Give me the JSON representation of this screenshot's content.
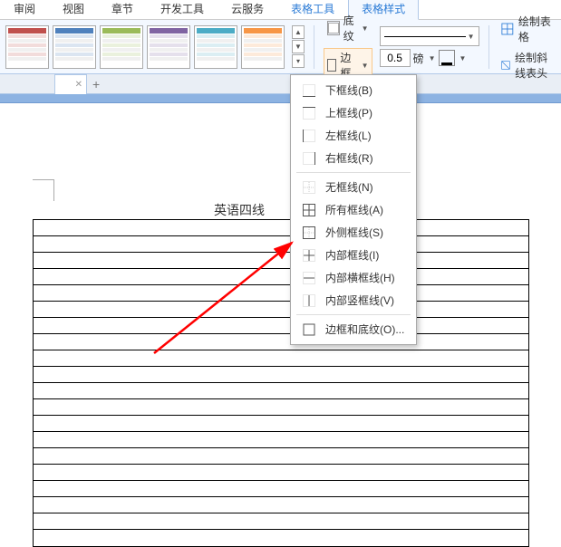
{
  "tabs": {
    "items": [
      {
        "label": "审阅",
        "active": false
      },
      {
        "label": "视图",
        "active": false
      },
      {
        "label": "章节",
        "active": false
      },
      {
        "label": "开发工具",
        "active": false
      },
      {
        "label": "云服务",
        "active": false
      },
      {
        "label": "表格工具",
        "active": false,
        "highlight": true
      },
      {
        "label": "表格样式",
        "active": true
      }
    ]
  },
  "ribbon": {
    "shading_label": "底纹",
    "border_label": "边框",
    "weight_value": "0.5",
    "weight_unit": "磅",
    "draw_table": "绘制表格",
    "draw_diagonal": "绘制斜线表头"
  },
  "document": {
    "title_fragment": "英语四线"
  },
  "border_menu": {
    "items": [
      {
        "label": "下框线(B)",
        "icon": "border-bottom"
      },
      {
        "label": "上框线(P)",
        "icon": "border-top"
      },
      {
        "label": "左框线(L)",
        "icon": "border-left"
      },
      {
        "label": "右框线(R)",
        "icon": "border-right"
      },
      {
        "label": "无框线(N)",
        "icon": "border-none",
        "sep_before": true
      },
      {
        "label": "所有框线(A)",
        "icon": "border-all"
      },
      {
        "label": "外侧框线(S)",
        "icon": "border-outside"
      },
      {
        "label": "内部框线(I)",
        "icon": "border-inside"
      },
      {
        "label": "内部横框线(H)",
        "icon": "border-inside-h"
      },
      {
        "label": "内部竖框线(V)",
        "icon": "border-inside-v"
      },
      {
        "label": "边框和底纹(O)...",
        "icon": "border-dialog",
        "sep_before": true
      }
    ]
  }
}
